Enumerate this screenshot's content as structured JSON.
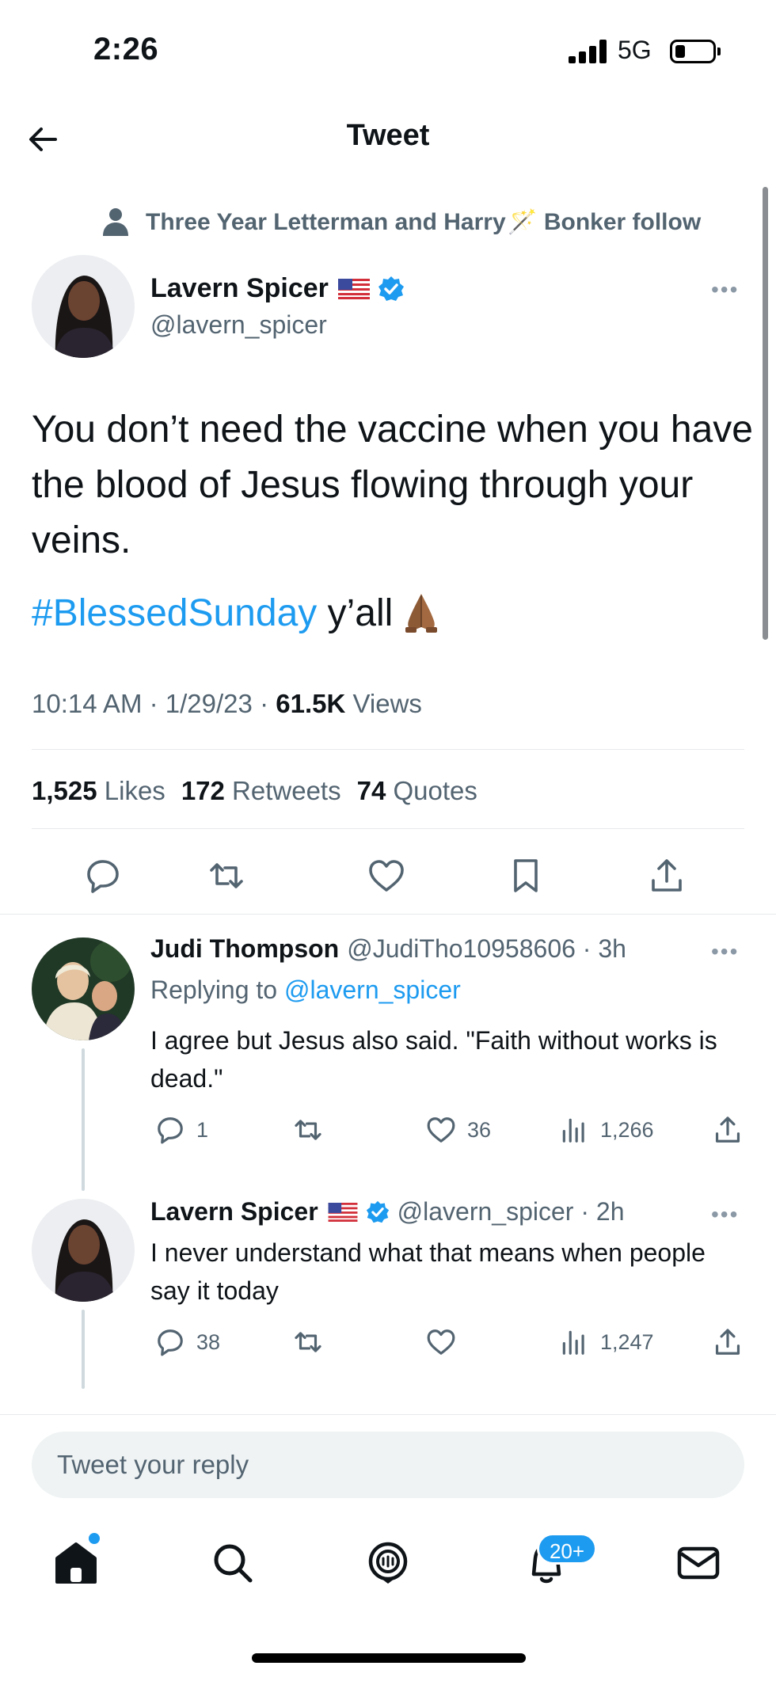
{
  "status_bar": {
    "time": "2:26",
    "network": "5G"
  },
  "header": {
    "title": "Tweet"
  },
  "social_context": {
    "text": "Three Year Letterman and Harry 🪄 Bonker follow"
  },
  "main_tweet": {
    "name": "Lavern Spicer",
    "handle": "@lavern_spicer",
    "body": "You don’t need the vaccine when you have the blood of Jesus flowing through your veins.",
    "hashtag": "#BlessedSunday",
    "tail": " y’all",
    "time": "10:14 AM",
    "date": "1/29/23",
    "views_count": "61.5K",
    "views_label": " Views",
    "likes_count": "1,525",
    "likes_label": " Likes",
    "retweets_count": "172",
    "retweets_label": " Retweets",
    "quotes_count": "74",
    "quotes_label": " Quotes"
  },
  "replies": [
    {
      "name": "Judi Thompson",
      "handle": "@JudiTho10958606 · 3h",
      "replying_prefix": "Replying to ",
      "replying_to": "@lavern_spicer",
      "text": "I agree but Jesus also said. \"Faith without works is dead.\"",
      "reply_count": "1",
      "retweet_count": "",
      "like_count": "36",
      "view_count": "1,266"
    },
    {
      "name": "Lavern Spicer",
      "handle": "@lavern_spicer · 2h",
      "text": "I never understand what that means when people say it today",
      "reply_count": "38",
      "retweet_count": "",
      "like_count": "",
      "view_count": "1,247"
    }
  ],
  "reply_box": {
    "placeholder": "Tweet your reply"
  },
  "tab_bar": {
    "notifications_badge": "20+"
  },
  "colors": {
    "accent": "#1d9bf0",
    "secondary_text": "#536471",
    "primary_text": "#0f1419"
  }
}
